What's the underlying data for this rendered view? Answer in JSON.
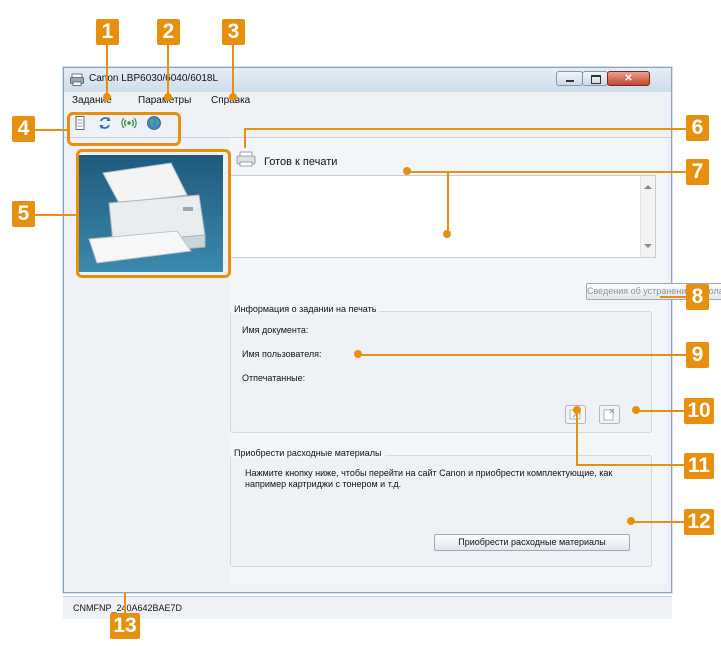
{
  "callouts": [
    "1",
    "2",
    "3",
    "4",
    "5",
    "6",
    "7",
    "8",
    "9",
    "10",
    "11",
    "12",
    "13"
  ],
  "window": {
    "title": "Canon LBP6030/6040/6018L"
  },
  "menu": {
    "items": [
      "Задание",
      "Параметры",
      "Справка"
    ]
  },
  "toolbar": {
    "icons": [
      "job-list-icon",
      "refresh-icon",
      "wireless-icon",
      "globe-icon"
    ]
  },
  "status": {
    "text": "Готов к печати",
    "message": ""
  },
  "troubleshoot_button": "Сведения об устранении неполадок",
  "job_info": {
    "title": "Информация о задании на печать",
    "fields": [
      "Имя документа:",
      "Имя пользователя:",
      "Отпечатанные:"
    ]
  },
  "supplies": {
    "title": "Приобрести расходные материалы",
    "description": "Нажмите кнопку ниже, чтобы перейти на сайт Canon и приобрести комплектующие, как например картриджи с тонером и т.д.",
    "button": "Приобрести расходные материалы"
  },
  "statusbar": {
    "text": "CNMFNP_240A642BAE7D"
  },
  "colors": {
    "callout": "#e8900d",
    "printer_bg": "#2a6f92"
  }
}
